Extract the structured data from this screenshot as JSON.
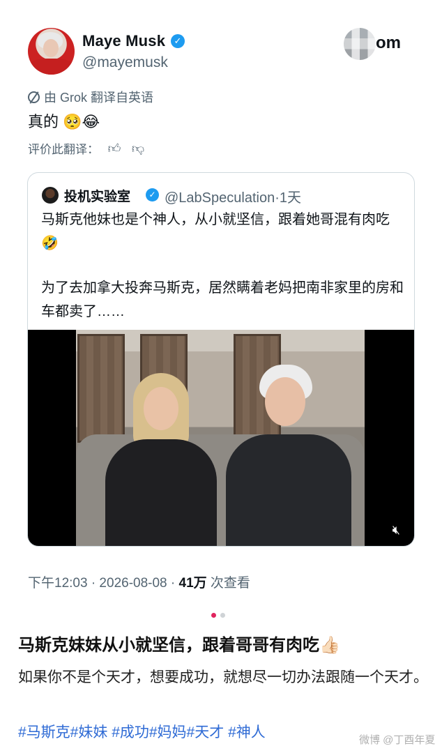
{
  "author": {
    "name": "Maye Musk",
    "handle": "@mayemusk"
  },
  "brand": {
    "suffix": "om"
  },
  "translation": {
    "note": "由 Grok 翻译自英语",
    "text": "真的 🥺😂",
    "rate_label": "评价此翻译："
  },
  "quote": {
    "name": "投机实验室",
    "handle": "@LabSpeculation",
    "time": "·1天",
    "para1": "马斯克他妹也是个神人，从小就坚信，跟着她哥混有肉吃🤣",
    "para2": "为了去加拿大投奔马斯克，居然瞒着老妈把南非家里的房和车都卖了……"
  },
  "meta": {
    "time_date": "下午12:03 · 2026-08-08 · ",
    "views": "41万",
    "views_label": " 次查看"
  },
  "post": {
    "title": "马斯克妹妹从小就坚信，跟着哥哥有肉吃👍🏻",
    "body": "如果你不是个天才，想要成功，就想尽一切办法跟随一个天才。",
    "tags": "#马斯克#妹妹 #成功#妈妈#天才 #神人",
    "watermark": "微博 @丁酉年夏"
  },
  "icons": [
    "verified-icon",
    "translate-icon",
    "thumbs-up-icon",
    "thumbs-down-icon",
    "mute-icon"
  ],
  "colors": {
    "verified": "#1d9bf0",
    "link": "#2f6bd5",
    "pager_active": "#e0245e"
  }
}
